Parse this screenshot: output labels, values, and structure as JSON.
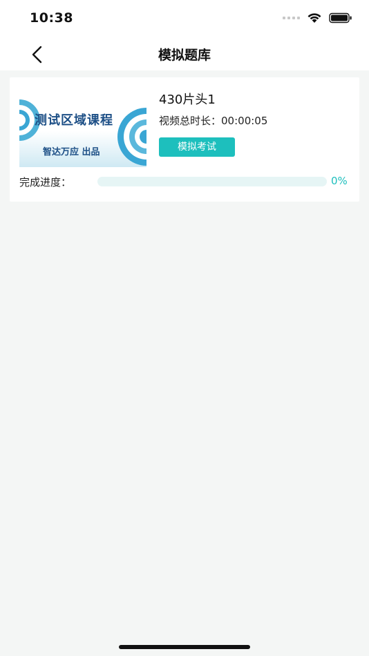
{
  "status_bar": {
    "time": "10:38"
  },
  "nav": {
    "title": "模拟题库",
    "back_icon": "chevron-left-icon"
  },
  "course": {
    "thumbnail": {
      "main_text": "测试区域课程",
      "sub_text": "智达万应  出品"
    },
    "title": "430片头1",
    "duration_label": "视频总时长：",
    "duration_value": "00:00:05",
    "exam_button_label": "模拟考试",
    "progress_label": "完成进度：",
    "progress_percent_text": "0%",
    "progress_value": 0
  },
  "colors": {
    "accent": "#1dbfbd",
    "track": "#e6f5f5",
    "background": "#f4f6f5",
    "thumb_text": "#1d4f86"
  }
}
